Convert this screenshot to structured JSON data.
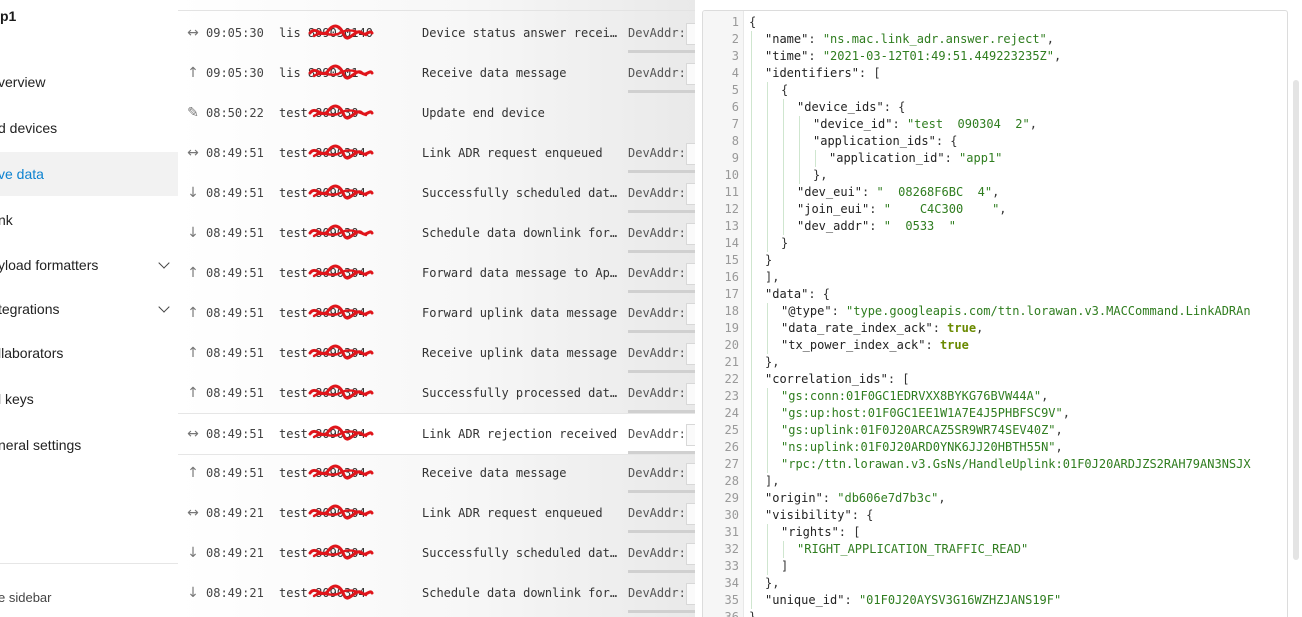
{
  "sidebar": {
    "app_title": "p1",
    "items": [
      {
        "label": "verview"
      },
      {
        "label": "d devices"
      },
      {
        "label": "ve data",
        "active": true
      },
      {
        "label": "nk"
      },
      {
        "label": "yload formatters",
        "expandable": true
      },
      {
        "label": "tegrations",
        "expandable": true
      },
      {
        "label": "llaborators"
      },
      {
        "label": "l keys"
      },
      {
        "label": "neral settings"
      }
    ],
    "footer": "e sidebar"
  },
  "events": [
    {
      "icon": "bidirectional-arrows-icon",
      "time": "09:05:30",
      "device": "lis 809030140",
      "message": "Device status answer recei…",
      "devaddr": "DevAddr:"
    },
    {
      "icon": "arrow-up-icon",
      "time": "09:05:30",
      "device": "lis 8090301 ",
      "message": "Receive data message",
      "devaddr": "DevAddr:"
    },
    {
      "icon": "pencil-icon",
      "time": "08:50:22",
      "device": "test 809030 ",
      "message": "Update end device",
      "devaddr": ""
    },
    {
      "icon": "bidirectional-arrows-icon",
      "time": "08:49:51",
      "device": "test 8090304 ",
      "message": "Link ADR request enqueued",
      "devaddr": "DevAddr:"
    },
    {
      "icon": "arrow-down-icon",
      "time": "08:49:51",
      "device": "test 8090304 ",
      "message": "Successfully scheduled dat…",
      "devaddr": "DevAddr:"
    },
    {
      "icon": "arrow-down-icon",
      "time": "08:49:51",
      "device": "test 809030 ",
      "message": "Schedule data downlink for…",
      "devaddr": "DevAddr:"
    },
    {
      "icon": "arrow-up-icon",
      "time": "08:49:51",
      "device": "test 8090304 ",
      "message": "Forward data message to Ap…",
      "devaddr": "DevAddr:"
    },
    {
      "icon": "arrow-up-icon",
      "time": "08:49:51",
      "device": "test 8090304 ",
      "message": "Forward uplink data message",
      "devaddr": "DevAddr:"
    },
    {
      "icon": "arrow-up-icon",
      "time": "08:49:51",
      "device": "test 8090304 ",
      "message": "Receive uplink data message",
      "devaddr": "DevAddr:"
    },
    {
      "icon": "arrow-up-icon",
      "time": "08:49:51",
      "device": "test 8090304 ",
      "message": "Successfully processed dat…",
      "devaddr": "DevAddr:"
    },
    {
      "icon": "bidirectional-arrows-icon",
      "time": "08:49:51",
      "device": "test 8090304 ",
      "message": "Link ADR rejection received",
      "devaddr": "DevAddr:",
      "selected": true
    },
    {
      "icon": "arrow-up-icon",
      "time": "08:49:51",
      "device": "test 8090304 ",
      "message": "Receive data message",
      "devaddr": "DevAddr:"
    },
    {
      "icon": "bidirectional-arrows-icon",
      "time": "08:49:21",
      "device": "test 8090304 ",
      "message": "Link ADR request enqueued",
      "devaddr": "DevAddr:"
    },
    {
      "icon": "arrow-down-icon",
      "time": "08:49:21",
      "device": "test 8090304 ",
      "message": "Successfully scheduled dat…",
      "devaddr": "DevAddr:"
    },
    {
      "icon": "arrow-down-icon",
      "time": "08:49:21",
      "device": "test 8090304 ",
      "message": "Schedule data downlink for…",
      "devaddr": "DevAddr:"
    }
  ],
  "json_lines": [
    {
      "n": "1",
      "indent": 0,
      "parts": [
        [
          "p",
          "{"
        ]
      ]
    },
    {
      "n": "2",
      "indent": 1,
      "parts": [
        [
          "k",
          "\"name\""
        ],
        [
          "p",
          ": "
        ],
        [
          "s",
          "\"ns.mac.link_adr.answer.reject\""
        ],
        [
          "p",
          ","
        ]
      ]
    },
    {
      "n": "3",
      "indent": 1,
      "parts": [
        [
          "k",
          "\"time\""
        ],
        [
          "p",
          ": "
        ],
        [
          "s",
          "\"2021-03-12T01:49:51.449223235Z\""
        ],
        [
          "p",
          ","
        ]
      ]
    },
    {
      "n": "4",
      "indent": 1,
      "parts": [
        [
          "k",
          "\"identifiers\""
        ],
        [
          "p",
          ": ["
        ]
      ]
    },
    {
      "n": "5",
      "indent": 2,
      "parts": [
        [
          "p",
          "{"
        ]
      ]
    },
    {
      "n": "6",
      "indent": 3,
      "parts": [
        [
          "k",
          "\"device_ids\""
        ],
        [
          "p",
          ": {"
        ]
      ]
    },
    {
      "n": "7",
      "indent": 4,
      "parts": [
        [
          "k",
          "\"device_id\""
        ],
        [
          "p",
          ": "
        ],
        [
          "s",
          "\"test  090304  2\""
        ],
        [
          "p",
          ","
        ]
      ]
    },
    {
      "n": "8",
      "indent": 4,
      "parts": [
        [
          "k",
          "\"application_ids\""
        ],
        [
          "p",
          ": {"
        ]
      ]
    },
    {
      "n": "9",
      "indent": 5,
      "parts": [
        [
          "k",
          "\"application_id\""
        ],
        [
          "p",
          ": "
        ],
        [
          "s",
          "\"app1\""
        ]
      ]
    },
    {
      "n": "10",
      "indent": 4,
      "parts": [
        [
          "p",
          "},"
        ]
      ]
    },
    {
      "n": "11",
      "indent": 3,
      "parts": [
        [
          "k",
          "\"dev_eui\""
        ],
        [
          "p",
          ": "
        ],
        [
          "s",
          "\"  08268F6BC  4\""
        ],
        [
          "p",
          ","
        ]
      ]
    },
    {
      "n": "12",
      "indent": 3,
      "parts": [
        [
          "k",
          "\"join_eui\""
        ],
        [
          "p",
          ": "
        ],
        [
          "s",
          "\"    C4C300    \""
        ],
        [
          "p",
          ","
        ]
      ]
    },
    {
      "n": "13",
      "indent": 3,
      "parts": [
        [
          "k",
          "\"dev_addr\""
        ],
        [
          "p",
          ": "
        ],
        [
          "s",
          "\"  0533  \""
        ]
      ]
    },
    {
      "n": "14",
      "indent": 2,
      "parts": [
        [
          "p",
          "}"
        ]
      ]
    },
    {
      "n": "15",
      "indent": 1,
      "parts": [
        [
          "p",
          "}"
        ]
      ]
    },
    {
      "n": "16",
      "indent": 1,
      "parts": [
        [
          "p",
          "],"
        ]
      ]
    },
    {
      "n": "17",
      "indent": 1,
      "parts": [
        [
          "k",
          "\"data\""
        ],
        [
          "p",
          ": {"
        ]
      ]
    },
    {
      "n": "18",
      "indent": 2,
      "parts": [
        [
          "k",
          "\"@type\""
        ],
        [
          "p",
          ": "
        ],
        [
          "s",
          "\"type.googleapis.com/ttn.lorawan.v3.MACCommand.LinkADRAn"
        ]
      ]
    },
    {
      "n": "19",
      "indent": 2,
      "parts": [
        [
          "k",
          "\"data_rate_index_ack\""
        ],
        [
          "p",
          ": "
        ],
        [
          "b",
          "true"
        ],
        [
          "p",
          ","
        ]
      ]
    },
    {
      "n": "20",
      "indent": 2,
      "parts": [
        [
          "k",
          "\"tx_power_index_ack\""
        ],
        [
          "p",
          ": "
        ],
        [
          "b",
          "true"
        ]
      ]
    },
    {
      "n": "21",
      "indent": 1,
      "parts": [
        [
          "p",
          "},"
        ]
      ]
    },
    {
      "n": "22",
      "indent": 1,
      "parts": [
        [
          "k",
          "\"correlation_ids\""
        ],
        [
          "p",
          ": ["
        ]
      ]
    },
    {
      "n": "23",
      "indent": 2,
      "parts": [
        [
          "s",
          "\"gs:conn:01F0GC1EDRVXX8BYKG76BVW44A\""
        ],
        [
          "p",
          ","
        ]
      ]
    },
    {
      "n": "24",
      "indent": 2,
      "parts": [
        [
          "s",
          "\"gs:up:host:01F0GC1EE1W1A7E4J5PHBFSC9V\""
        ],
        [
          "p",
          ","
        ]
      ]
    },
    {
      "n": "25",
      "indent": 2,
      "parts": [
        [
          "s",
          "\"gs:uplink:01F0J20ARCAZ5SR9WR74SEV40Z\""
        ],
        [
          "p",
          ","
        ]
      ]
    },
    {
      "n": "26",
      "indent": 2,
      "parts": [
        [
          "s",
          "\"ns:uplink:01F0J20ARD0YNK6JJ20HBTH55N\""
        ],
        [
          "p",
          ","
        ]
      ]
    },
    {
      "n": "27",
      "indent": 2,
      "parts": [
        [
          "s",
          "\"rpc:/ttn.lorawan.v3.GsNs/HandleUplink:01F0J20ARDJZS2RAH79AN3NSJX"
        ]
      ]
    },
    {
      "n": "28",
      "indent": 1,
      "parts": [
        [
          "p",
          "],"
        ]
      ]
    },
    {
      "n": "29",
      "indent": 1,
      "parts": [
        [
          "k",
          "\"origin\""
        ],
        [
          "p",
          ": "
        ],
        [
          "s",
          "\"db606e7d7b3c\""
        ],
        [
          "p",
          ","
        ]
      ]
    },
    {
      "n": "30",
      "indent": 1,
      "parts": [
        [
          "k",
          "\"visibility\""
        ],
        [
          "p",
          ": {"
        ]
      ]
    },
    {
      "n": "31",
      "indent": 2,
      "parts": [
        [
          "k",
          "\"rights\""
        ],
        [
          "p",
          ": ["
        ]
      ]
    },
    {
      "n": "32",
      "indent": 3,
      "parts": [
        [
          "s",
          "\"RIGHT_APPLICATION_TRAFFIC_READ\""
        ]
      ]
    },
    {
      "n": "33",
      "indent": 2,
      "parts": [
        [
          "p",
          "]"
        ]
      ]
    },
    {
      "n": "34",
      "indent": 1,
      "parts": [
        [
          "p",
          "},"
        ]
      ]
    },
    {
      "n": "35",
      "indent": 1,
      "parts": [
        [
          "k",
          "\"unique_id\""
        ],
        [
          "p",
          ": "
        ],
        [
          "s",
          "\"01F0J20AYSV3G16WZHZJANS19F\""
        ]
      ]
    },
    {
      "n": "36",
      "indent": 0,
      "parts": [
        [
          "p",
          "}"
        ]
      ]
    }
  ]
}
